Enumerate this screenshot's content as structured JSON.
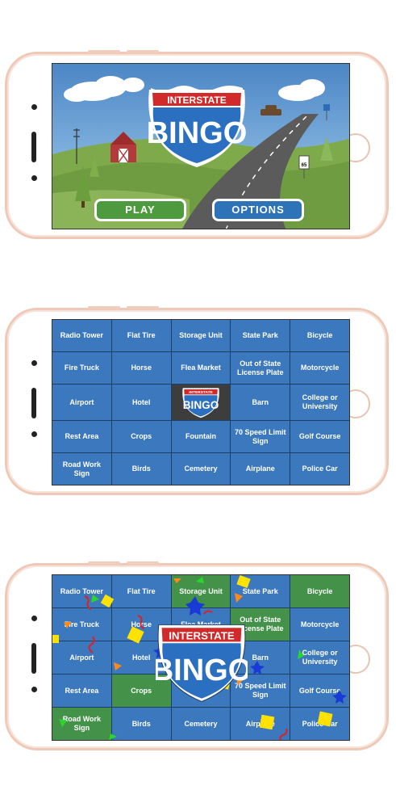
{
  "colors": {
    "phone_frame": "#efc9b8",
    "tile_blue": "#3c78bd",
    "tile_green": "#44924a",
    "free_tile": "#3d3d3d",
    "play_button": "#4d9a3f",
    "options_button": "#2e73b8"
  },
  "menu_screen": {
    "logo": {
      "top_text": "INTERSTATE",
      "main_text": "BINGO"
    },
    "speed_sign": {
      "text": "65"
    },
    "play_label": "PLAY",
    "options_label": "OPTIONS"
  },
  "board": {
    "cells": [
      {
        "label": "Radio Tower"
      },
      {
        "label": "Flat Tire"
      },
      {
        "label": "Storage Unit"
      },
      {
        "label": "State Park"
      },
      {
        "label": "Bicycle"
      },
      {
        "label": "Fire Truck"
      },
      {
        "label": "Horse"
      },
      {
        "label": "Flea Market"
      },
      {
        "label": "Out of State License Plate"
      },
      {
        "label": "Motorcycle"
      },
      {
        "label": "Airport"
      },
      {
        "label": "Hotel"
      },
      {
        "label": "FREE"
      },
      {
        "label": "Barn"
      },
      {
        "label": "College or University"
      },
      {
        "label": "Rest Area"
      },
      {
        "label": "Crops"
      },
      {
        "label": "Fountain"
      },
      {
        "label": "70 Speed Limit Sign"
      },
      {
        "label": "Golf Course"
      },
      {
        "label": "Road Work Sign"
      },
      {
        "label": "Birds"
      },
      {
        "label": "Cemetery"
      },
      {
        "label": "Airplane"
      },
      {
        "label": "Police Car"
      }
    ],
    "free_logo": {
      "top_text": "INTERSTATE",
      "main_text": "BINGO"
    }
  },
  "win_screen": {
    "marked_cells": [
      "Bicycle",
      "Out of State License Plate",
      "Crops",
      "Road Work Sign",
      "Storage Unit"
    ],
    "logo": {
      "top_text": "INTERSTATE",
      "main_text": "BINGO"
    }
  }
}
